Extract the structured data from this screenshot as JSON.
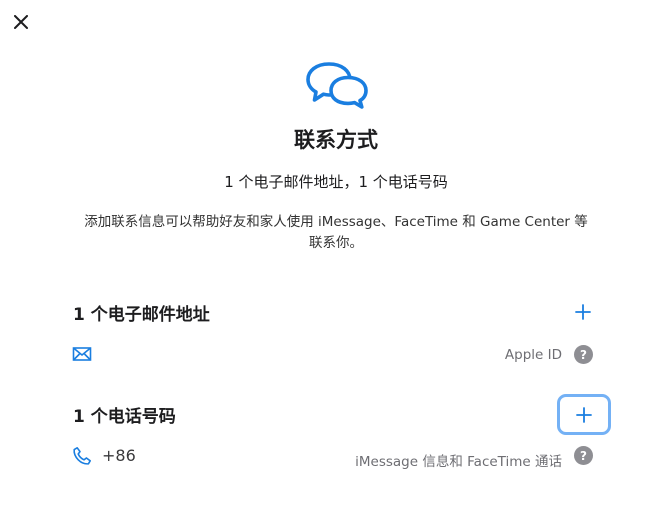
{
  "dialog": {
    "close_icon": "close-icon",
    "hero_icon": "chat-bubbles-icon",
    "title": "联系方式",
    "summary": "1 个电子邮件地址，1 个电话号码",
    "description": "添加联系信息可以帮助好友和家人使用 iMessage、FaceTime 和 Game Center 等联系你。"
  },
  "email_section": {
    "title": "1 个电子邮件地址",
    "add_icon": "plus-icon",
    "row": {
      "icon": "envelope-icon",
      "value": "",
      "note": "Apple ID",
      "help_label": "?"
    }
  },
  "phone_section": {
    "title": "1 个电话号码",
    "add_icon": "plus-icon",
    "row": {
      "icon": "phone-icon",
      "value": "+86",
      "note": "iMessage 信息和 FaceTime 通话",
      "help_label": "?"
    }
  },
  "colors": {
    "accent": "#1a7ee0",
    "focus_ring": "#74b1f5",
    "help_badge": "#8e8e93",
    "text_primary": "#1d1d1f",
    "text_secondary": "#6e6e73"
  }
}
